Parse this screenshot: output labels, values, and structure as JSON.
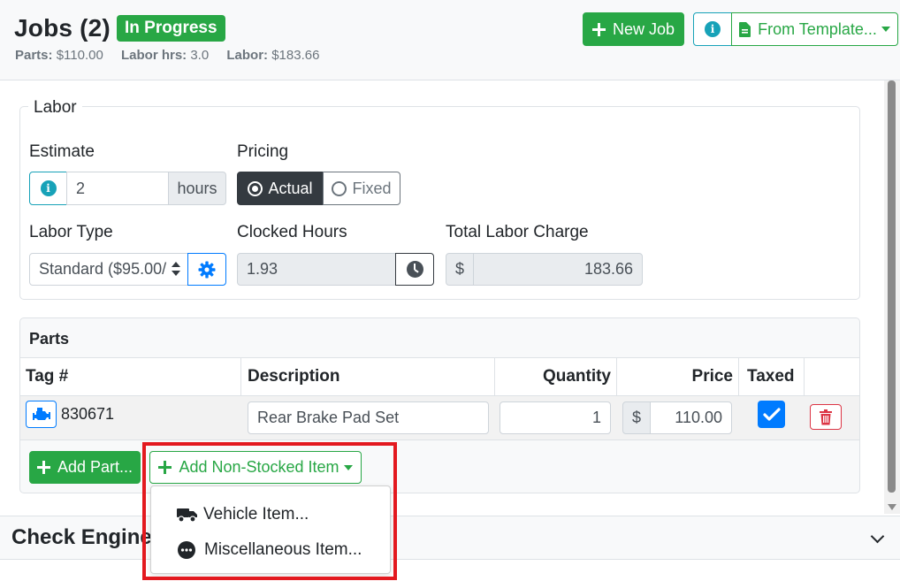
{
  "header": {
    "title": "Jobs (2)",
    "status_badge": "In Progress",
    "parts_label": "Parts:",
    "parts_value": "$110.00",
    "labor_hrs_label": "Labor hrs:",
    "labor_hrs_value": "3.0",
    "labor_label": "Labor:",
    "labor_value": "$183.66",
    "new_job_label": "New Job",
    "from_template_label": "From Template..."
  },
  "labor": {
    "legend": "Labor",
    "estimate_label": "Estimate",
    "estimate_value": "2",
    "estimate_unit": "hours",
    "pricing_label": "Pricing",
    "pricing_options": [
      "Actual",
      "Fixed"
    ],
    "pricing_selected": "Actual",
    "labor_type_label": "Labor Type",
    "labor_type_value": "Standard ($95.00/",
    "clocked_hours_label": "Clocked Hours",
    "clocked_hours_value": "1.93",
    "total_charge_label": "Total Labor Charge",
    "currency_symbol": "$",
    "total_charge_value": "183.66"
  },
  "parts": {
    "title": "Parts",
    "columns": [
      "Tag #",
      "Description",
      "Quantity",
      "Price",
      "Taxed"
    ],
    "rows": [
      {
        "tag": "830671",
        "description": "Rear Brake Pad Set",
        "quantity": "1",
        "currency": "$",
        "price": "110.00",
        "taxed": true
      }
    ],
    "add_part_label": "Add Part...",
    "add_non_stocked_label": "Add Non-Stocked Item",
    "dropdown_items": [
      "Vehicle Item...",
      "Miscellaneous Item..."
    ]
  },
  "next_section": {
    "title": "Check Engine"
  },
  "colors": {
    "green": "#28a745",
    "teal": "#17a2b8",
    "blue": "#007bff",
    "red": "#dc3545",
    "dark": "#343a40",
    "highlight": "#e3191f"
  },
  "icons": [
    "plus-icon",
    "info-icon",
    "file-icon",
    "caret-down-icon",
    "gear-icon",
    "clock-icon",
    "engine-icon",
    "check-icon",
    "trash-icon",
    "truck-icon",
    "ellipsis-circle-icon",
    "chevron-down-icon"
  ]
}
